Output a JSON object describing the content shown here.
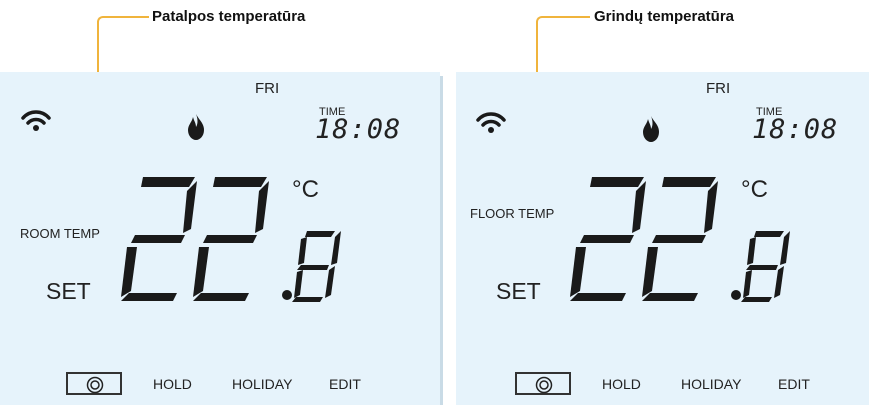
{
  "callouts": [
    {
      "label": "Patalpos temperatūra"
    },
    {
      "label": "Grindų temperatūra"
    }
  ],
  "panels": [
    {
      "day": "FRI",
      "time_label": "TIME",
      "time_value": "18:08",
      "mode_label": "ROOM TEMP",
      "set_label": "SET",
      "temp_integer": "22",
      "temp_decimal": "8",
      "temp_unit": "°C",
      "menu": [
        "HOLD",
        "HOLIDAY",
        "EDIT"
      ]
    },
    {
      "day": "FRI",
      "time_label": "TIME",
      "time_value": "18:08",
      "mode_label": "FLOOR TEMP",
      "set_label": "SET",
      "temp_integer": "22",
      "temp_decimal": "8",
      "temp_unit": "°C",
      "menu": [
        "HOLD",
        "HOLIDAY",
        "EDIT"
      ]
    }
  ],
  "colors": {
    "panel_bg": "#e6f3fb",
    "callout": "#f0b43c",
    "segment": "#1a1a1a"
  }
}
